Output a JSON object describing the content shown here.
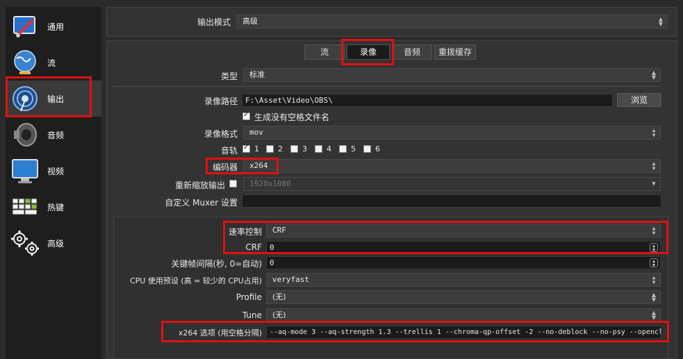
{
  "sidebar": {
    "items": [
      {
        "label": "通用",
        "icon": "tools-icon"
      },
      {
        "label": "流",
        "icon": "globe-icon"
      },
      {
        "label": "输出",
        "icon": "broadcast-icon"
      },
      {
        "label": "音频",
        "icon": "speaker-icon"
      },
      {
        "label": "视频",
        "icon": "monitor-icon"
      },
      {
        "label": "热键",
        "icon": "keyboard-icon"
      },
      {
        "label": "高级",
        "icon": "gears-icon"
      }
    ],
    "selected": "输出"
  },
  "output_mode": {
    "label": "输出模式",
    "value": "高级"
  },
  "tabs": [
    {
      "label": "流"
    },
    {
      "label": "录像"
    },
    {
      "label": "音频"
    },
    {
      "label": "重拨缓存"
    }
  ],
  "recording": {
    "type_label": "类型",
    "type_value": "标准",
    "path_label": "录像路径",
    "path_value": "F:\\Asset\\Video\\OBS\\",
    "browse_label": "浏览",
    "no_space_label": "生成没有空格文件名",
    "format_label": "录像格式",
    "format_value": "mov",
    "tracks_label": "音轨",
    "tracks": [
      "1",
      "2",
      "3",
      "4",
      "5",
      "6"
    ],
    "encoder_label": "编码器",
    "encoder_value": "x264",
    "rescale_label": "重新缩放输出",
    "rescale_value": "1920x1080",
    "muxer_label": "自定义 Muxer 设置",
    "muxer_value": ""
  },
  "encoder_settings": {
    "rate_control_label": "速率控制",
    "rate_control_value": "CRF",
    "crf_label": "CRF",
    "crf_value": "0",
    "keyframe_label": "关键帧间隔(秒, 0=自动)",
    "keyframe_value": "0",
    "preset_label": "CPU 使用预设 (高 = 较少的 CPU占用)",
    "preset_value": "veryfast",
    "profile_label": "Profile",
    "profile_value": "(无)",
    "tune_label": "Tune",
    "tune_value": "(无)",
    "x264opts_label": "x264 选项 (用空格分隔)",
    "x264opts_value": "--aq-mode 3 --aq-strength 1.3 --trellis 1 --chroma-qp-offset -2 --no-deblock --no-psy --opencl"
  },
  "colors": {
    "highlight": "#e31010",
    "selected_bg": "#3a3a3a"
  }
}
